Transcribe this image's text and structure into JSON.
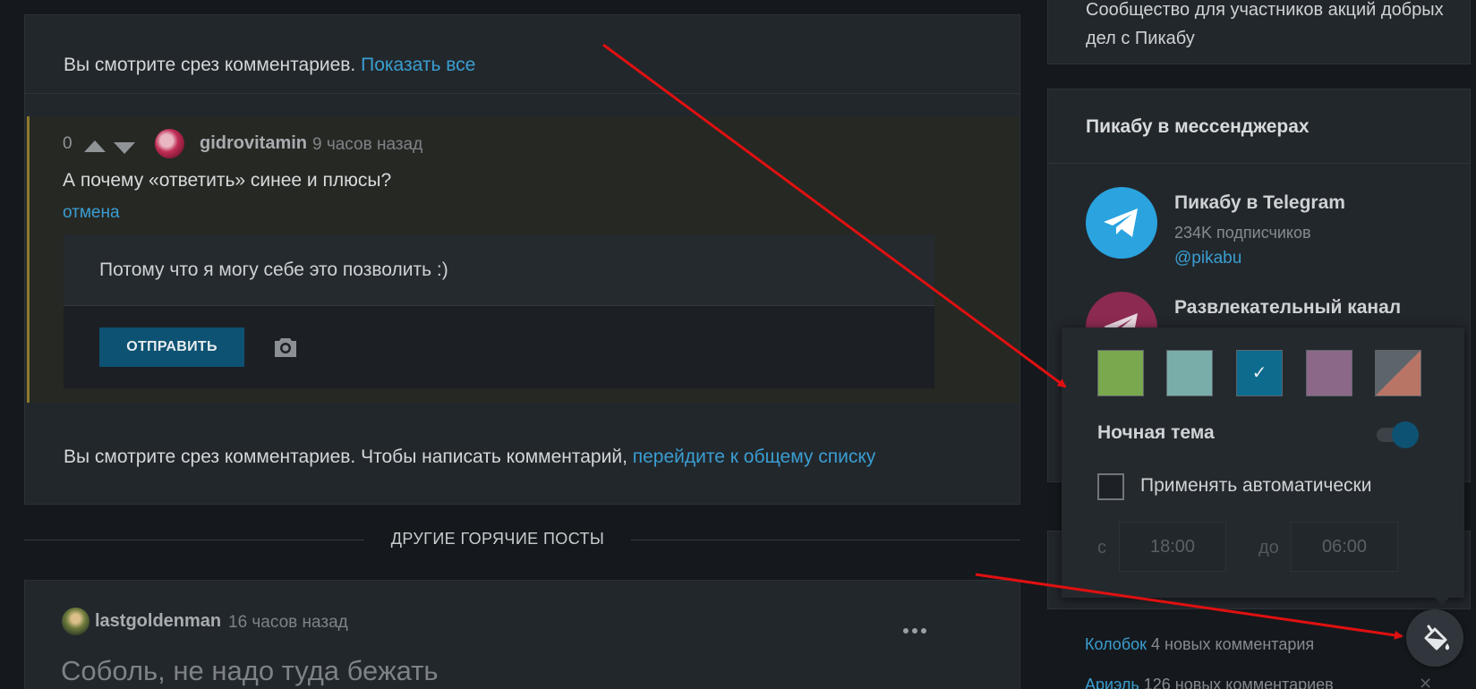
{
  "comments_card": {
    "slice_top_text": "Вы смотрите срез комментариев.",
    "show_all_link": "Показать все",
    "comment": {
      "rating": "0",
      "user": "gidrovitamin",
      "time": "9 часов назад",
      "text": "А почему «ответить» синее и плюсы?",
      "cancel_link": "отмена"
    },
    "reply": {
      "text": "Потому что я могу себе это позволить :)",
      "send_label": "ОТПРАВИТЬ"
    },
    "slice_bottom_text": "Вы смотрите срез комментариев. Чтобы написать комментарий,",
    "slice_bottom_link": "перейдите к общему списку"
  },
  "hot_posts": {
    "title": "ДРУГИЕ ГОРЯЧИЕ ПОСТЫ",
    "post": {
      "user": "lastgoldenman",
      "time": "16 часов назад",
      "title": "Соболь, не надо туда бежать"
    }
  },
  "sidebar": {
    "community_text": "Сообщество для участников акций добрых дел с Пикабу",
    "messengers": {
      "heading": "Пикабу в мессенджерах",
      "telegram": {
        "title": "Пикабу в Telegram",
        "subscribers": "234K подписчиков",
        "handle": "@pikabu"
      },
      "entertainment": {
        "title": "Развлекательный канал"
      }
    },
    "comments": [
      {
        "link": "Колобок",
        "text": "4 новых комментария"
      },
      {
        "link": "Ариэль",
        "text": "126 новых комментариев"
      }
    ]
  },
  "theme_popup": {
    "swatches": [
      {
        "name": "green",
        "color": "#7aa84e",
        "selected": false
      },
      {
        "name": "teal",
        "color": "#79ada9",
        "selected": false
      },
      {
        "name": "blue",
        "color": "#0d6b8e",
        "selected": true
      },
      {
        "name": "purple",
        "color": "#8c6888",
        "selected": false
      },
      {
        "name": "gray-red",
        "color": "#b87566",
        "selected": false
      }
    ],
    "check_mark": "✓",
    "night_theme_label": "Ночная тема",
    "night_theme_on": true,
    "auto_apply_label": "Применять автоматически",
    "auto_apply_checked": false,
    "from_label": "с",
    "from_time": "18:00",
    "to_label": "до",
    "to_time": "06:00"
  },
  "colors": {
    "accent": "#3a9ed1",
    "button": "#0d5272",
    "annotation_arrow": "#e01010"
  }
}
